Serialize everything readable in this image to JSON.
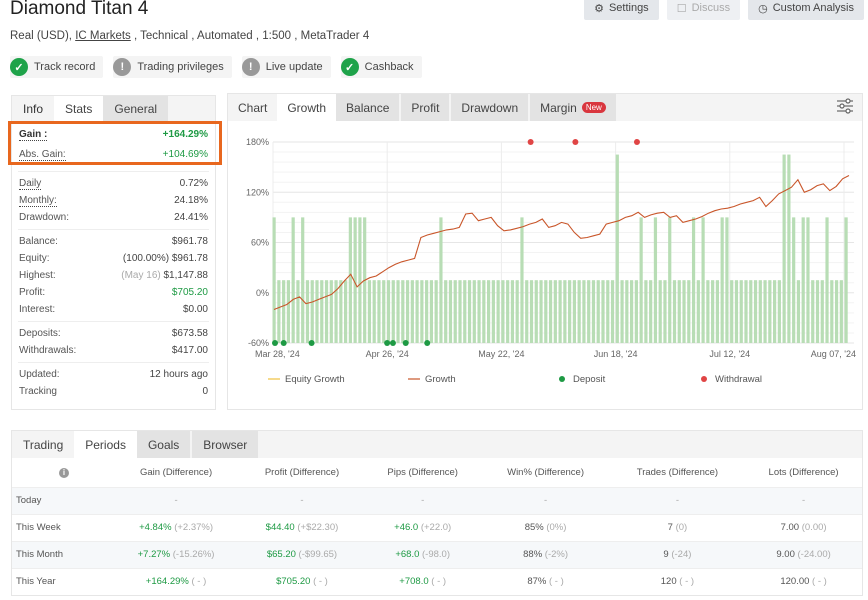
{
  "header": {
    "title": "Diamond Titan 4",
    "subtitle_prefix": "Real (USD), ",
    "broker_link": "IC Markets",
    "subtitle_suffix": " , Technical , Automated , 1:500 , MetaTrader 4",
    "buttons": [
      {
        "label": "Settings",
        "icon": "gear-icon",
        "disabled": false
      },
      {
        "label": "Discuss",
        "icon": "comment-icon",
        "disabled": true
      },
      {
        "label": "Custom Analysis",
        "icon": "clock-icon",
        "disabled": false
      }
    ],
    "badges": [
      {
        "label": "Track record",
        "status": "ok"
      },
      {
        "label": "Trading privileges",
        "status": "warn"
      },
      {
        "label": "Live update",
        "status": "warn"
      },
      {
        "label": "Cashback",
        "status": "ok"
      }
    ]
  },
  "info_panel": {
    "tabs": [
      "Info",
      "Stats",
      "General"
    ],
    "gain_label": "Gain :",
    "gain_value": "+164.29%",
    "abs_gain_label": "Abs. Gain:",
    "abs_gain_value": "+104.69%",
    "daily_label": "Daily",
    "daily_value": "0.72%",
    "monthly_label": "Monthly:",
    "monthly_value": "24.18%",
    "drawdown_label": "Drawdown:",
    "drawdown_value": "24.41%",
    "balance_label": "Balance:",
    "balance_value": "$961.78",
    "equity_label": "Equity:",
    "equity_pct": "(100.00%)",
    "equity_value": "$961.78",
    "highest_label": "Highest:",
    "highest_date": "(May 16)",
    "highest_value": "$1,147.88",
    "profit_label": "Profit:",
    "profit_value": "$705.20",
    "interest_label": "Interest:",
    "interest_value": "$0.00",
    "deposits_label": "Deposits:",
    "deposits_value": "$673.58",
    "withdrawals_label": "Withdrawals:",
    "withdrawals_value": "$417.00",
    "updated_label": "Updated:",
    "updated_value": "12 hours ago",
    "tracking_label": "Tracking",
    "tracking_value": "0"
  },
  "chart_panel": {
    "tabs": [
      "Chart",
      "Growth",
      "Balance",
      "Profit",
      "Drawdown",
      "Margin"
    ],
    "new_badge": "New",
    "filter_icon": "sliders-icon"
  },
  "chart_data": {
    "type": "line",
    "title": "",
    "xlabel": "",
    "ylabel": "",
    "ylim": [
      -60,
      180
    ],
    "yticks": [
      "180%",
      "120%",
      "60%",
      "0%",
      "-60%"
    ],
    "ytick_values": [
      180,
      120,
      60,
      0,
      -60
    ],
    "xticks": [
      "Mar 28, '24",
      "Apr 26, '24",
      "May 22, '24",
      "Jun 18, '24",
      "Jul 12, '24",
      "Aug 07, '24"
    ],
    "grid": true,
    "legend": {
      "position": "bottom",
      "entries": [
        {
          "name": "Equity Growth",
          "color": "#f0c040",
          "kind": "line"
        },
        {
          "name": "Growth",
          "color": "#c9562a",
          "kind": "line"
        },
        {
          "name": "Deposit",
          "color": "#1e9a44",
          "kind": "dot"
        },
        {
          "name": "Withdrawal",
          "color": "#e04545",
          "kind": "dot"
        }
      ]
    },
    "series": [
      {
        "name": "Growth",
        "color": "#c9562a",
        "points": [
          [
            0,
            -20
          ],
          [
            2,
            -17
          ],
          [
            4,
            -14
          ],
          [
            6,
            -8
          ],
          [
            8,
            -5
          ],
          [
            10,
            -13
          ],
          [
            12,
            -11
          ],
          [
            14,
            -8
          ],
          [
            16,
            -5
          ],
          [
            18,
            -2
          ],
          [
            20,
            5
          ],
          [
            22,
            14
          ],
          [
            24,
            22
          ],
          [
            26,
            7
          ],
          [
            28,
            14
          ],
          [
            30,
            18
          ],
          [
            32,
            20
          ],
          [
            34,
            25
          ],
          [
            36,
            30
          ],
          [
            38,
            34
          ],
          [
            40,
            37
          ],
          [
            42,
            39
          ],
          [
            44,
            41
          ],
          [
            46,
            66
          ],
          [
            48,
            69
          ],
          [
            50,
            71
          ],
          [
            52,
            73
          ],
          [
            54,
            75
          ],
          [
            56,
            76
          ],
          [
            58,
            78
          ],
          [
            60,
            94
          ],
          [
            62,
            95
          ],
          [
            64,
            86
          ],
          [
            66,
            88
          ],
          [
            68,
            90
          ],
          [
            70,
            80
          ],
          [
            72,
            74
          ],
          [
            74,
            75
          ],
          [
            76,
            77
          ],
          [
            78,
            79
          ],
          [
            80,
            82
          ],
          [
            82,
            84
          ],
          [
            84,
            88
          ],
          [
            86,
            78
          ],
          [
            88,
            80
          ],
          [
            90,
            84
          ],
          [
            92,
            82
          ],
          [
            94,
            72
          ],
          [
            96,
            65
          ],
          [
            98,
            66
          ],
          [
            100,
            68
          ],
          [
            102,
            70
          ],
          [
            104,
            82
          ],
          [
            106,
            84
          ],
          [
            108,
            86
          ],
          [
            110,
            90
          ],
          [
            112,
            92
          ],
          [
            114,
            96
          ],
          [
            116,
            90
          ],
          [
            118,
            93
          ],
          [
            120,
            95
          ],
          [
            122,
            96
          ],
          [
            124,
            90
          ],
          [
            126,
            92
          ],
          [
            128,
            84
          ],
          [
            130,
            86
          ],
          [
            132,
            88
          ],
          [
            134,
            91
          ],
          [
            136,
            95
          ],
          [
            138,
            98
          ],
          [
            140,
            100
          ],
          [
            142,
            101
          ],
          [
            144,
            103
          ],
          [
            146,
            106
          ],
          [
            148,
            108
          ],
          [
            150,
            110
          ],
          [
            152,
            114
          ],
          [
            154,
            103
          ],
          [
            156,
            110
          ],
          [
            158,
            118
          ],
          [
            160,
            122
          ],
          [
            162,
            126
          ],
          [
            164,
            135
          ],
          [
            166,
            120
          ],
          [
            168,
            123
          ],
          [
            170,
            128
          ],
          [
            172,
            130
          ],
          [
            174,
            122
          ],
          [
            176,
            127
          ],
          [
            178,
            136
          ],
          [
            180,
            140
          ]
        ]
      },
      {
        "name": "Bars",
        "color": "#b8ddb5",
        "levels": [
          2,
          1,
          1,
          1,
          2,
          1,
          2,
          1,
          1,
          1,
          1,
          1,
          1,
          1,
          1,
          1,
          2,
          2,
          2,
          2,
          1,
          1,
          1,
          1,
          1,
          1,
          1,
          1,
          1,
          1,
          1,
          1,
          1,
          1,
          1,
          2,
          1,
          1,
          1,
          1,
          1,
          1,
          1,
          1,
          1,
          1,
          1,
          1,
          1,
          1,
          1,
          1,
          2,
          1,
          1,
          1,
          1,
          1,
          1,
          1,
          1,
          1,
          1,
          1,
          1,
          1,
          1,
          1,
          1,
          1,
          1,
          1,
          3,
          1,
          1,
          1,
          1,
          2,
          1,
          1,
          2,
          1,
          1,
          2,
          1,
          1,
          1,
          1,
          2,
          1,
          2,
          1,
          1,
          1,
          2,
          2,
          1,
          1,
          1,
          1,
          1,
          1,
          1,
          1,
          1,
          1,
          1,
          3,
          3,
          2,
          1,
          2,
          2,
          1,
          1,
          1,
          2,
          1,
          1,
          1,
          2
        ],
        "level_values": [
          -60,
          15,
          90,
          165
        ]
      },
      {
        "name": "Deposit",
        "color": "#1e9a44",
        "x_frac": [
          0.0,
          0.015,
          0.063,
          0.193,
          0.203,
          0.225,
          0.262
        ]
      },
      {
        "name": "Withdrawal",
        "color": "#e04545",
        "x_frac": [
          0.44,
          0.517,
          0.623
        ]
      }
    ]
  },
  "periods_table": {
    "tabs": [
      "Trading",
      "Periods",
      "Goals",
      "Browser"
    ],
    "columns": [
      "",
      "Gain (Difference)",
      "Profit (Difference)",
      "Pips (Difference)",
      "Win% (Difference)",
      "Trades (Difference)",
      "Lots (Difference)"
    ],
    "rows": [
      {
        "period": "Today",
        "cells": [
          [
            "-",
            ""
          ],
          [
            "-",
            ""
          ],
          [
            "-",
            ""
          ],
          [
            "-",
            ""
          ],
          [
            "-",
            ""
          ],
          [
            "-",
            ""
          ]
        ]
      },
      {
        "period": "This Week",
        "cells": [
          [
            "+4.84%",
            "(+2.37%)"
          ],
          [
            "$44.40",
            "(+$22.30)"
          ],
          [
            "+46.0",
            "(+22.0)"
          ],
          [
            "85%",
            "(0%)"
          ],
          [
            "7",
            "(0)"
          ],
          [
            "7.00",
            "(0.00)"
          ]
        ]
      },
      {
        "period": "This Month",
        "cells": [
          [
            "+7.27%",
            "(-15.26%)"
          ],
          [
            "$65.20",
            "(-$99.65)"
          ],
          [
            "+68.0",
            "(-98.0)"
          ],
          [
            "88%",
            "(-2%)"
          ],
          [
            "9",
            "(-24)"
          ],
          [
            "9.00",
            "(-24.00)"
          ]
        ]
      },
      {
        "period": "This Year",
        "cells": [
          [
            "+164.29%",
            "( - )"
          ],
          [
            "$705.20",
            "( - )"
          ],
          [
            "+708.0",
            "( - )"
          ],
          [
            "87%",
            "( - )"
          ],
          [
            "120",
            "( - )"
          ],
          [
            "120.00",
            "( - )"
          ]
        ]
      }
    ]
  }
}
